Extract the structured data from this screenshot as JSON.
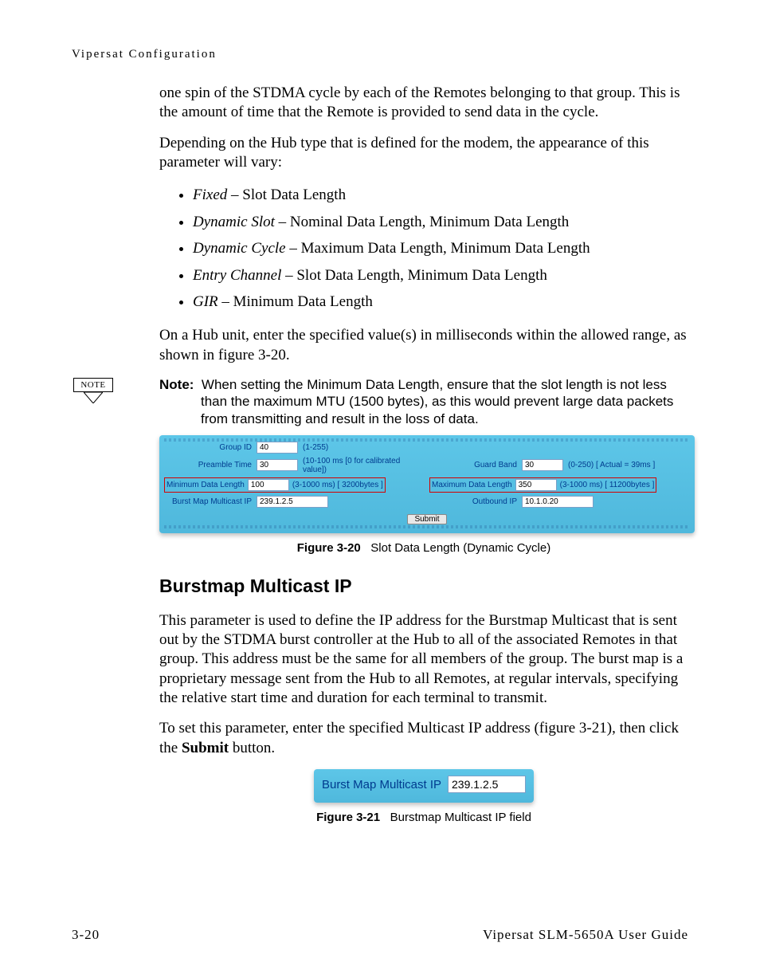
{
  "running_head": "Vipersat Configuration",
  "para1": "one spin of the STDMA cycle by each of the Remotes belonging to that group. This is the amount of time that the Remote is provided to send data in the cycle.",
  "para2": "Depending on the Hub type that is defined for the modem, the appearance of this parameter will vary:",
  "bullets": [
    {
      "name": "Fixed",
      "rest": " – Slot Data Length"
    },
    {
      "name": "Dynamic Slot",
      "rest": " – Nominal Data Length, Minimum Data Length"
    },
    {
      "name": "Dynamic Cycle",
      "rest": " – Maximum Data Length, Minimum Data Length"
    },
    {
      "name": "Entry Channel",
      "rest": " – Slot Data Length, Minimum Data Length"
    },
    {
      "name": "GIR",
      "rest": " – Minimum Data Length"
    }
  ],
  "para3": "On a Hub unit, enter the specified value(s) in milliseconds within the allowed range, as shown in figure 3-20.",
  "note_label": "NOTE",
  "note_prefix": "Note:",
  "note_body": "When setting the Minimum Data Length, ensure that the slot length is not less than the maximum MTU (1500 bytes), as this would prevent large data packets from transmitting and result in the loss of data.",
  "fig320": {
    "group_id": {
      "label": "Group ID",
      "value": "40",
      "hint": "(1-255)"
    },
    "preamble": {
      "label": "Preamble Time",
      "value": "30",
      "hint": "(10-100 ms [0 for calibrated value])"
    },
    "guard": {
      "label": "Guard Band",
      "value": "30",
      "hint": "(0-250) [ Actual = 39ms ]"
    },
    "min_len": {
      "label": "Minimum Data Length",
      "value": "100",
      "hint": "(3-1000 ms) [ 3200bytes ]"
    },
    "max_len": {
      "label": "Maximum Data Length",
      "value": "350",
      "hint": "(3-1000 ms) [ 11200bytes ]"
    },
    "burst_ip": {
      "label": "Burst Map Multicast IP",
      "value": "239.1.2.5"
    },
    "out_ip": {
      "label": "Outbound IP",
      "value": "10.1.0.20"
    },
    "submit": "Submit"
  },
  "fig320_cap_b": "Figure 3-20",
  "fig320_cap_r": "Slot Data Length (Dynamic Cycle)",
  "h2": "Burstmap Multicast IP",
  "para4": "This parameter is used to define the IP address for the Burstmap Multicast that is sent out by the STDMA burst controller at the Hub to all of the associated Remotes in that group. This address must be the same for all members of the group. The burst map is a proprietary message sent from the Hub to all Remotes, at regular intervals, specifying the relative start time and duration for each terminal to transmit.",
  "para5_a": "To set this parameter, enter the specified Multicast IP address (figure 3-21), then click the ",
  "para5_b": "Submit",
  "para5_c": " button.",
  "fig321": {
    "label": "Burst Map Multicast IP",
    "value": "239.1.2.5"
  },
  "fig321_cap_b": "Figure 3-21",
  "fig321_cap_r": "Burstmap Multicast IP field",
  "footer_left": "3-20",
  "footer_right": "Vipersat SLM-5650A User Guide"
}
